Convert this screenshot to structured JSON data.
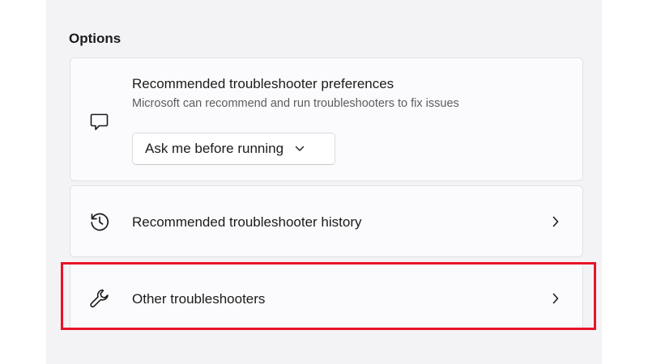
{
  "options": {
    "section_title": "Options",
    "preferences": {
      "title": "Recommended troubleshooter preferences",
      "description": "Microsoft can recommend and run troubleshooters to fix issues",
      "icon": "chat-bubble-icon",
      "dropdown_selected": "Ask me before running"
    },
    "history": {
      "title": "Recommended troubleshooter history",
      "icon": "history-clock-icon"
    },
    "other": {
      "title": "Other troubleshooters",
      "icon": "wrench-icon"
    }
  },
  "colors": {
    "highlight": "#e8132a",
    "panel_background": "#f3f3f6",
    "card_background": "#fbfbfd"
  }
}
